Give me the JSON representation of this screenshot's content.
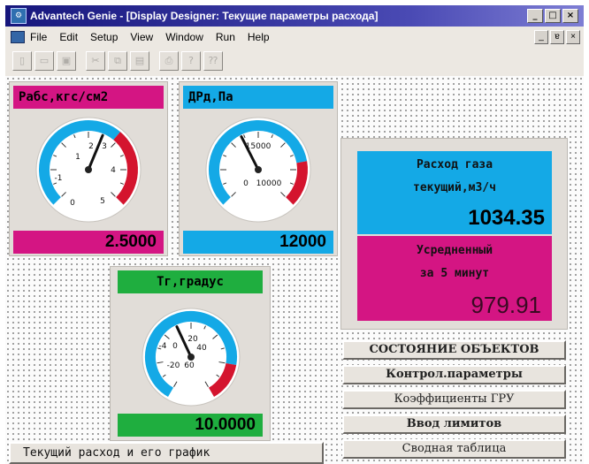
{
  "window": {
    "title": "Advantech Genie - [Display Designer: Текущие параметры расхода]",
    "controls": [
      "_",
      "□",
      "×"
    ],
    "mdi_controls": [
      "_",
      "ɐ",
      "×"
    ]
  },
  "menu": [
    "File",
    "Edit",
    "Setup",
    "View",
    "Window",
    "Run",
    "Help"
  ],
  "toolbar": {
    "icons": [
      "new-icon",
      "open-icon",
      "save-icon",
      "cut-icon",
      "copy-icon",
      "paste-icon",
      "print-icon",
      "help-icon",
      "context-help-icon"
    ],
    "glyphs": [
      "▯",
      "▭",
      "▣",
      "✂",
      "⧉",
      "▤",
      "⎙",
      "?",
      "⁇"
    ]
  },
  "gauges": {
    "pressure": {
      "title": "Рабс,кгс/см2",
      "value": "2.5000",
      "ticks": [
        "-1",
        "0",
        "1",
        "2",
        "3",
        "4",
        "5"
      ],
      "title_color": "#d41583",
      "value_color": "#d41583",
      "range": [
        -1,
        5
      ],
      "reading": 2.5
    },
    "diffpressure": {
      "title": "ДРд,Па",
      "value": "12000",
      "ticks": [
        "15000",
        "0",
        "10000"
      ],
      "title_color": "#14a9e6",
      "value_color": "#14a9e6",
      "range": [
        0,
        30000
      ],
      "reading": 12000
    },
    "temperature": {
      "title": "Тг,градус",
      "value": "10.0000",
      "ticks": [
        "-4",
        "0",
        "20",
        "40",
        "-20",
        "60"
      ],
      "title_color": "#1fae3f",
      "value_color": "#1fae3f",
      "range": [
        -40,
        80
      ],
      "reading": 10
    }
  },
  "flow": {
    "current_label_line1": "Расход газа",
    "current_label_line2": "текущий,м3/ч",
    "current_value": "1034.35",
    "avg_label_line1": "Усредненный",
    "avg_label_line2": "за 5 минут",
    "avg_value": "979.91"
  },
  "nav_buttons": [
    "СОСТОЯНИЕ ОБЪЕКТОВ",
    "Контрол.параметры",
    "Коэффициенты ГРУ",
    "Ввод лимитов",
    "Сводная таблица"
  ],
  "bottom_button": "Текущий расход и его график",
  "colors": {
    "gauge_arc_blue": "#14a9e6",
    "gauge_arc_red": "#d4142e",
    "title_bar": "#16167c"
  }
}
